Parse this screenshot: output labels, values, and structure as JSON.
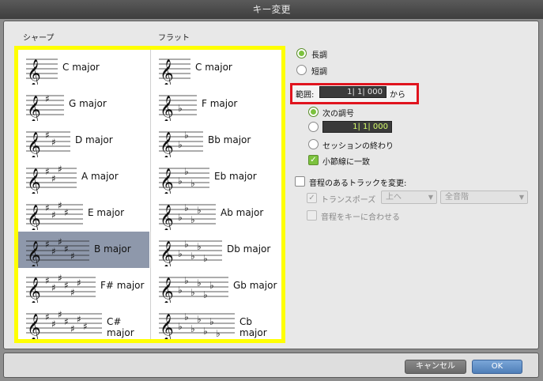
{
  "window": {
    "title": "キー変更"
  },
  "columns": {
    "sharps": "シャープ",
    "flats": "フラット"
  },
  "sharp_keys": [
    {
      "label": "C major",
      "accidentals": 0
    },
    {
      "label": "G major",
      "accidentals": 1
    },
    {
      "label": "D major",
      "accidentals": 2
    },
    {
      "label": "A major",
      "accidentals": 3
    },
    {
      "label": "E major",
      "accidentals": 4
    },
    {
      "label": "B major",
      "accidentals": 5
    },
    {
      "label": "F# major",
      "accidentals": 6
    },
    {
      "label": "C# major",
      "accidentals": 7
    }
  ],
  "flat_keys": [
    {
      "label": "C major",
      "accidentals": 0
    },
    {
      "label": "F major",
      "accidentals": 1
    },
    {
      "label": "Bb major",
      "accidentals": 2
    },
    {
      "label": "Eb major",
      "accidentals": 3
    },
    {
      "label": "Ab major",
      "accidentals": 4
    },
    {
      "label": "Db major",
      "accidentals": 5
    },
    {
      "label": "Gb major",
      "accidentals": 6
    },
    {
      "label": "Cb major",
      "accidentals": 7
    }
  ],
  "selected_key": "B major",
  "mode": {
    "major": "長調",
    "minor": "短調",
    "selected": "major"
  },
  "range": {
    "label": "範囲:",
    "start_value": "1| 1| 000",
    "from": "から",
    "to_next_key": "次の調号",
    "to_position_value": "1| 1| 000",
    "to_session_end": "セッションの終わり",
    "selected": "next_key",
    "snap_to_bar": "小節線に一致",
    "snap_checked": true
  },
  "transpose": {
    "label": "音程のあるトラックを変更:",
    "checked": false,
    "transpose_label": "トランスポーズ",
    "direction": "上へ",
    "scale": "全音階",
    "pitch_to_key": "音程をキーに合わせる"
  },
  "buttons": {
    "cancel": "キャンセル",
    "ok": "OK"
  },
  "colors": {
    "highlight_yellow": "#ffff00",
    "red_box": "#e0141e",
    "selected_row": "#8e98ab",
    "radio_on": "#7cc23e"
  }
}
